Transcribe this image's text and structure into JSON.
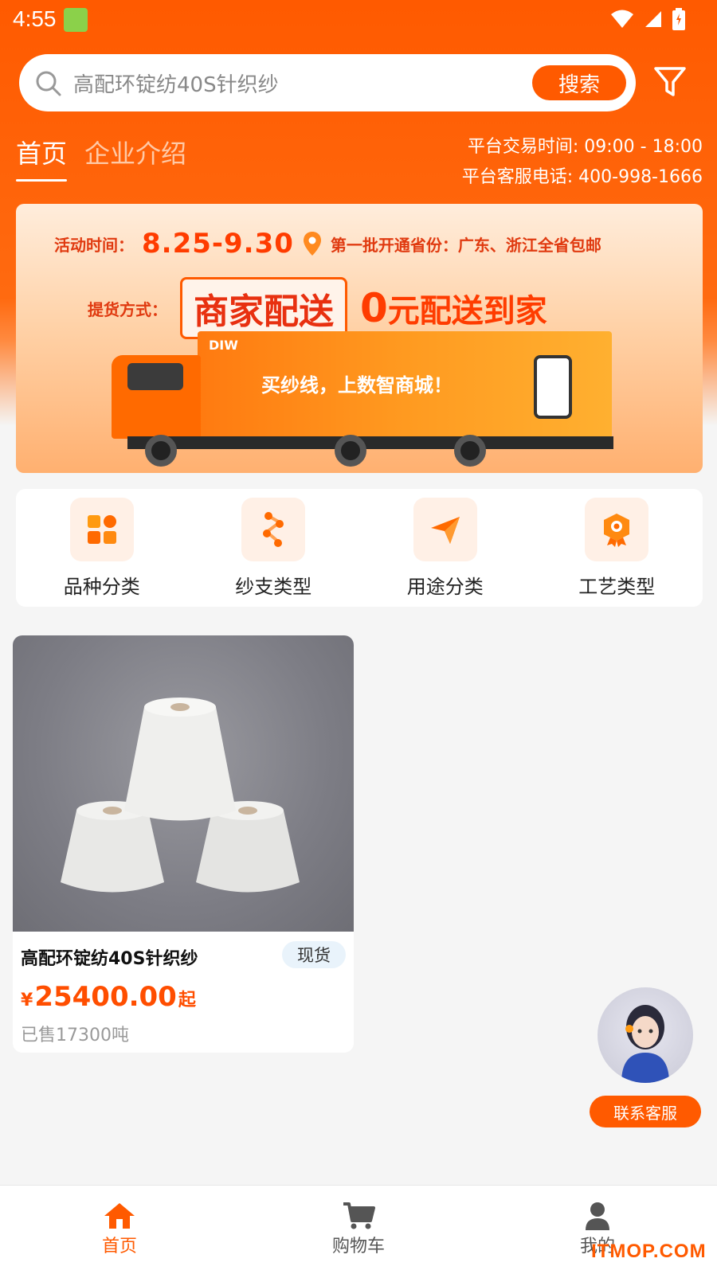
{
  "status_bar": {
    "time": "4:55"
  },
  "search": {
    "query": "高配环锭纺40S针织纱",
    "button_label": "搜索"
  },
  "tabs": [
    {
      "label": "首页",
      "active": true
    },
    {
      "label": "企业介绍",
      "active": false
    }
  ],
  "platform": {
    "trade_time": "平台交易时间: 09:00 - 18:00",
    "service_phone": "平台客服电话: 400-998-1666"
  },
  "banner": {
    "activity_label": "活动时间：",
    "activity_dates": "8.25-9.30",
    "regions": "第一批开通省份：广东、浙江全省包邮",
    "pickup_label": "提货方式：",
    "pickup_method": "商家配送",
    "zero": "0",
    "free_delivery": "元配送到家",
    "truck_slogan": "买纱线，上数智商城！",
    "truck_logo": "DIW"
  },
  "categories": [
    {
      "label": "品种分类",
      "icon": "grid-icon"
    },
    {
      "label": "纱支类型",
      "icon": "branch-icon"
    },
    {
      "label": "用途分类",
      "icon": "send-icon"
    },
    {
      "label": "工艺类型",
      "icon": "badge-icon"
    }
  ],
  "products": [
    {
      "name": "高配环锭纺40S针织纱",
      "badge": "现货",
      "price_symbol": "¥",
      "price": "25400.00",
      "price_suffix": "起",
      "sold": "已售17300吨"
    }
  ],
  "customer_service": {
    "label": "联系客服"
  },
  "bottom_nav": [
    {
      "label": "首页",
      "icon": "home-icon",
      "active": true
    },
    {
      "label": "购物车",
      "icon": "cart-icon",
      "active": false
    },
    {
      "label": "我的",
      "icon": "user-icon",
      "active": false
    }
  ],
  "watermark": "ITMOP.COM",
  "colors": {
    "brand": "#ff5a00",
    "price": "#ff4e00"
  }
}
